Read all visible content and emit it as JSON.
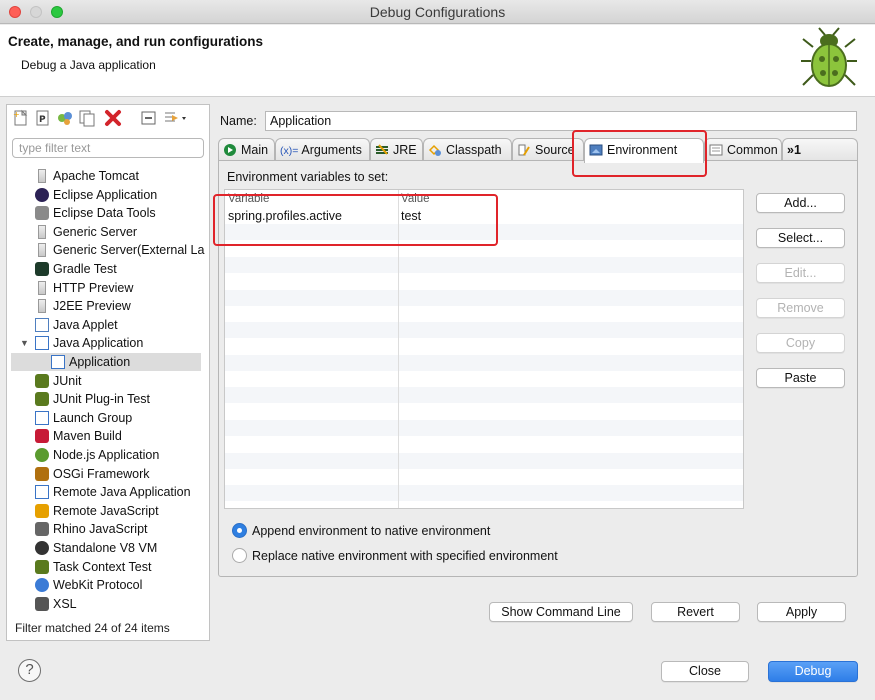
{
  "window": {
    "title": "Debug Configurations"
  },
  "header": {
    "title": "Create, manage, and run configurations",
    "subtitle": "Debug a Java application"
  },
  "left": {
    "filter_placeholder": "type filter text",
    "tree": [
      {
        "label": "Apache Tomcat",
        "icon": "server-icon",
        "level": 1
      },
      {
        "label": "Eclipse Application",
        "icon": "eclipse-icon",
        "level": 1
      },
      {
        "label": "Eclipse Data Tools",
        "icon": "database-icon",
        "level": 1
      },
      {
        "label": "Generic Server",
        "icon": "server-icon",
        "level": 1
      },
      {
        "label": "Generic Server(External La",
        "icon": "server-icon",
        "level": 1
      },
      {
        "label": "Gradle Test",
        "icon": "gradle-icon",
        "level": 1
      },
      {
        "label": "HTTP Preview",
        "icon": "server-icon",
        "level": 1
      },
      {
        "label": "J2EE Preview",
        "icon": "server-icon",
        "level": 1
      },
      {
        "label": "Java Applet",
        "icon": "applet-icon",
        "level": 1
      },
      {
        "label": "Java Application",
        "icon": "java-app-icon",
        "level": 1,
        "expanded": true
      },
      {
        "label": "Application",
        "icon": "java-app-icon",
        "level": 2,
        "selected": true
      },
      {
        "label": "JUnit",
        "icon": "junit-icon",
        "level": 1
      },
      {
        "label": "JUnit Plug-in Test",
        "icon": "junit-plugin-icon",
        "level": 1
      },
      {
        "label": "Launch Group",
        "icon": "launch-group-icon",
        "level": 1
      },
      {
        "label": "Maven Build",
        "icon": "maven-icon",
        "level": 1
      },
      {
        "label": "Node.js Application",
        "icon": "nodejs-icon",
        "level": 1
      },
      {
        "label": "OSGi Framework",
        "icon": "osgi-icon",
        "level": 1
      },
      {
        "label": "Remote Java Application",
        "icon": "remote-java-icon",
        "level": 1
      },
      {
        "label": "Remote JavaScript",
        "icon": "remote-js-icon",
        "level": 1
      },
      {
        "label": "Rhino JavaScript",
        "icon": "rhino-icon",
        "level": 1
      },
      {
        "label": "Standalone V8 VM",
        "icon": "v8-icon",
        "level": 1
      },
      {
        "label": "Task Context Test",
        "icon": "task-test-icon",
        "level": 1
      },
      {
        "label": "WebKit Protocol",
        "icon": "webkit-icon",
        "level": 1
      },
      {
        "label": "XSL",
        "icon": "xsl-icon",
        "level": 1
      }
    ],
    "filter_message": "Filter matched 24 of 24 items"
  },
  "config": {
    "name_label": "Name:",
    "name_value": "Application",
    "tabs": [
      {
        "label": "Main",
        "icon": "main-tab-icon"
      },
      {
        "label": "Arguments",
        "icon": "arguments-icon",
        "prefix": "(x)="
      },
      {
        "label": "JRE",
        "icon": "jre-icon"
      },
      {
        "label": "Classpath",
        "icon": "classpath-icon"
      },
      {
        "label": "Source",
        "icon": "source-icon"
      },
      {
        "label": "Environment",
        "icon": "environment-icon",
        "active": true
      },
      {
        "label": "Common",
        "icon": "common-icon"
      },
      {
        "label": "»1",
        "icon": "overflow-icon"
      }
    ],
    "env_label": "Environment variables to set:",
    "columns": [
      "Variable",
      "Value"
    ],
    "rows": [
      {
        "variable": "spring.profiles.active",
        "value": "test"
      }
    ],
    "side_buttons": [
      {
        "label": "Add...",
        "enabled": true
      },
      {
        "label": "Select...",
        "enabled": true
      },
      {
        "label": "Edit...",
        "enabled": false
      },
      {
        "label": "Remove",
        "enabled": false
      },
      {
        "label": "Copy",
        "enabled": false
      },
      {
        "label": "Paste",
        "enabled": true
      }
    ],
    "radio_append": "Append environment to native environment",
    "radio_replace": "Replace native environment with specified environment",
    "show_cmd": "Show Command Line",
    "revert": "Revert",
    "apply": "Apply"
  },
  "footer": {
    "close": "Close",
    "debug": "Debug"
  },
  "colors": {
    "accent": "#2f7fe1",
    "highlight": "#e0242a"
  }
}
